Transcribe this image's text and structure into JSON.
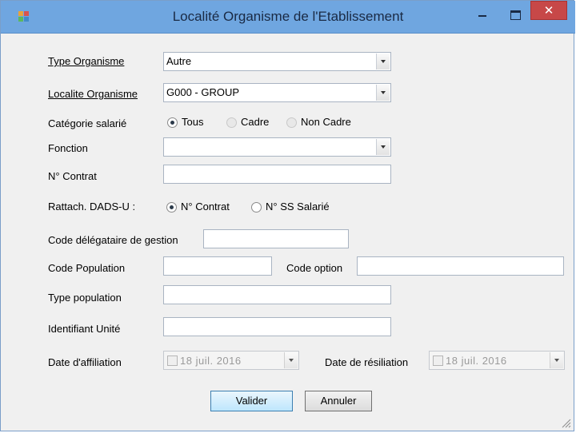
{
  "window": {
    "title": "Localité Organisme de l'Etablissement",
    "close_glyph": "✕"
  },
  "form": {
    "type_organisme": {
      "label": "Type Organisme",
      "value": "Autre"
    },
    "localite_organisme": {
      "label": "Localite Organisme",
      "value": "G000 - GROUP"
    },
    "categorie": {
      "label": "Catégorie salarié",
      "options": [
        "Tous",
        "Cadre",
        "Non Cadre"
      ],
      "selected": "Tous"
    },
    "fonction": {
      "label": "Fonction",
      "value": ""
    },
    "n_contrat": {
      "label": "N° Contrat",
      "value": ""
    },
    "rattach": {
      "label": "Rattach. DADS-U :",
      "options": [
        "N° Contrat",
        "N° SS Salarié"
      ],
      "selected": "N° Contrat"
    },
    "code_delegataire": {
      "label": "Code délégataire de gestion",
      "value": ""
    },
    "code_population": {
      "label": "Code Population",
      "value": ""
    },
    "code_option": {
      "label": "Code option",
      "value": ""
    },
    "type_population": {
      "label": "Type population",
      "value": ""
    },
    "identifiant_unite": {
      "label": "Identifiant Unité",
      "value": ""
    },
    "date_affiliation": {
      "label": "Date d'affiliation",
      "value": "18  juil.  2016"
    },
    "date_resiliation": {
      "label": "Date de résiliation",
      "value": "18  juil.  2016"
    }
  },
  "buttons": {
    "valider": "Valider",
    "annuler": "Annuler"
  },
  "colors": {
    "titlebar": "#6fa6e0",
    "close": "#c74848",
    "accent_button": "#bee6fd"
  }
}
